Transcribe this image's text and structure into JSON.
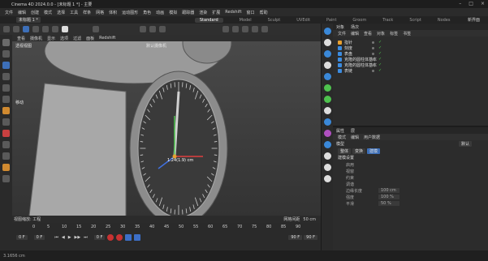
{
  "window": {
    "title": "Cinema 4D 2024.0.0 - [未标题 1 *] - 主要",
    "doc_tab": "未标题 1 *"
  },
  "menubar": {
    "items": [
      "文件",
      "编辑",
      "创建",
      "模式",
      "选择",
      "工具",
      "样条",
      "网格",
      "体积",
      "运动图形",
      "角色",
      "动画",
      "模拟",
      "跟踪器",
      "渲染",
      "扩展",
      "Redshift",
      "窗口",
      "帮助"
    ],
    "search_placeholder": "",
    "layout_tabs": [
      {
        "label": "Standard",
        "active": true
      },
      {
        "label": "Model",
        "active": false
      },
      {
        "label": "Sculpt",
        "active": false
      },
      {
        "label": "UVEdit",
        "active": false
      },
      {
        "label": "Paint",
        "active": false
      },
      {
        "label": "Groom",
        "active": false
      },
      {
        "label": "Track",
        "active": false
      },
      {
        "label": "Script",
        "active": false
      },
      {
        "label": "Nodes",
        "active": false
      }
    ],
    "new_layouts_label": "新界面"
  },
  "viewport": {
    "menu": [
      "查看",
      "摄像机",
      "显示",
      "选项",
      "过滤",
      "面板",
      "Redshift"
    ],
    "label": "透视视图",
    "camera_label": "默认摄像机",
    "hud_text": "1.24(1.9) cm",
    "speed_label": "移动",
    "footer_left": "视图缩放: 工程",
    "footer_right_label": "网格间距",
    "footer_right_value": "50 cm"
  },
  "object_manager": {
    "tabs": [
      "对象",
      "场次"
    ],
    "menu": [
      "文件",
      "编辑",
      "查看",
      "对象",
      "标签",
      "书签"
    ],
    "objects": [
      {
        "name": "指针",
        "icon_color": "#e8a030",
        "checked": true
      },
      {
        "name": "刻度",
        "icon_color": "#3c8ce0",
        "checked": true
      },
      {
        "name": "表盘",
        "icon_color": "#3c8ce0",
        "checked": true
      },
      {
        "name": "克隆的圆柱体基本",
        "icon_color": "#3c8ce0",
        "checked": true
      },
      {
        "name": "克隆的圆柱体基本",
        "icon_color": "#3c8ce0",
        "checked": true
      },
      {
        "name": "表链",
        "icon_color": "#3c8ce0",
        "checked": true
      }
    ]
  },
  "attribute_manager": {
    "tabs": [
      "属性",
      "层"
    ],
    "menu": [
      "模式",
      "编辑",
      "用户数据"
    ],
    "title_label": "模型",
    "mode_tabs": [
      "整体",
      "变换",
      "建模"
    ],
    "section": "建模设置",
    "rows": [
      {
        "label": "启用",
        "value": ""
      },
      {
        "label": "视窗",
        "value": ""
      },
      {
        "label": "约束",
        "value": ""
      },
      {
        "label": "调谐",
        "value": ""
      },
      {
        "label": "边缘长度",
        "value": "100 cm"
      },
      {
        "label": "强度",
        "value": "100 %"
      },
      {
        "label": "平滑",
        "value": "50 %"
      }
    ],
    "dropdown": "默认"
  },
  "timeline": {
    "ruler": [
      "0",
      "5",
      "10",
      "15",
      "20",
      "25",
      "30",
      "35",
      "40",
      "45",
      "50",
      "55",
      "60",
      "65",
      "70",
      "75",
      "80",
      "85",
      "90"
    ],
    "start": "0 F",
    "current": "0 F",
    "end": "90 F",
    "end2": "90 F",
    "frame_field": "0 F"
  },
  "status": {
    "text": "3.1656 cm"
  }
}
